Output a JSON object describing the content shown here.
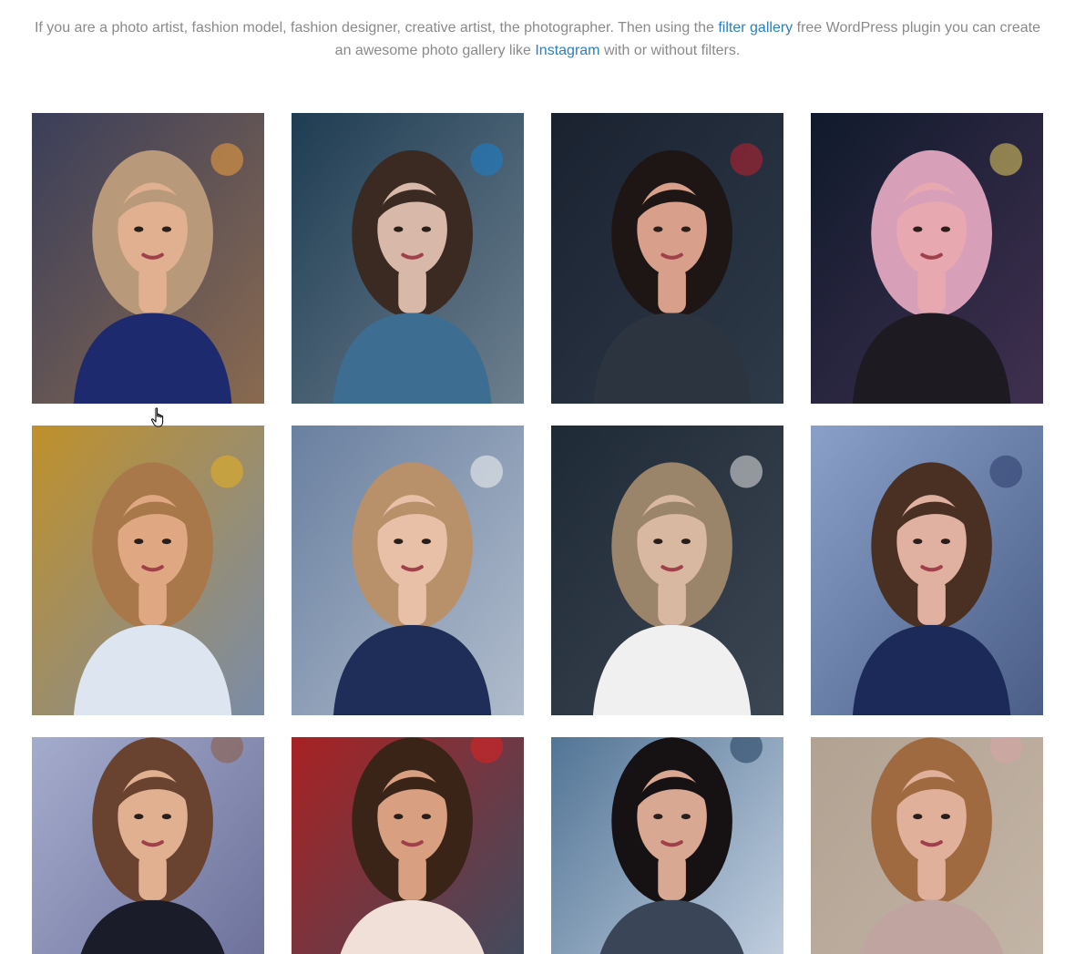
{
  "intro": {
    "text_before_link1": "If you are a photo artist, fashion model, fashion designer, creative artist, the photographer. Then using the ",
    "link1": "filter gallery",
    "text_between": " free WordPress plugin you can create an awesome photo gallery like ",
    "link2": "Instagram",
    "text_after": " with or without filters."
  },
  "colors": {
    "body_text": "#8a8a8a",
    "link": "#2a7fc0"
  },
  "gallery": {
    "photos": [
      {
        "name": "photo-1",
        "bg": [
          "#3a3e5a",
          "#8a6a50"
        ],
        "hair": "#b89a7a",
        "skin": "#e0b090",
        "cloth": "#1e2a6e",
        "accent": "#f0a040",
        "accent_label": "lamp-light"
      },
      {
        "name": "photo-2",
        "bg": [
          "#1f3c52",
          "#6c7f8e"
        ],
        "hair": "#3a2a22",
        "skin": "#d8b8a8",
        "cloth": "#3d6e92",
        "accent": "#1a7fd0",
        "accent_label": "blue-sunglasses"
      },
      {
        "name": "photo-3",
        "bg": [
          "#1a2230",
          "#2e3a48"
        ],
        "hair": "#1e1614",
        "skin": "#d8a08a",
        "cloth": "#2c3440",
        "accent": "#c02030",
        "accent_label": "red-lips"
      },
      {
        "name": "photo-4",
        "bg": [
          "#101a2c",
          "#403050"
        ],
        "hair": "#d8a0b8",
        "skin": "#e8a8b0",
        "cloth": "#1e1a22",
        "accent": "#e8d060",
        "accent_label": "glowing-phone"
      },
      {
        "name": "photo-5",
        "bg": [
          "#c0902a",
          "#7a8ca8"
        ],
        "hair": "#a8784a",
        "skin": "#e0a882",
        "cloth": "#dde6f0",
        "accent": "#e8b020",
        "accent_label": "yellow-pillow"
      },
      {
        "name": "photo-6",
        "bg": [
          "#6a80a0",
          "#b0bccc"
        ],
        "hair": "#b8906a",
        "skin": "#e8c0a8",
        "cloth": "#1e2e58",
        "accent": "#f4f4f4",
        "accent_label": "striped-pillow"
      },
      {
        "name": "photo-7",
        "bg": [
          "#1e2a36",
          "#3c4652"
        ],
        "hair": "#9a846a",
        "skin": "#d8b8a0",
        "cloth": "#f0f0f0",
        "accent": "#e8e8e8",
        "accent_label": "white-fur"
      },
      {
        "name": "photo-8",
        "bg": [
          "#8aa0c8",
          "#4a5e88"
        ],
        "hair": "#4a3022",
        "skin": "#e0b0a0",
        "cloth": "#1c2a5a",
        "accent": "#2a3a6a",
        "accent_label": "navy-dress"
      },
      {
        "name": "photo-9",
        "bg": [
          "#a8b0d0",
          "#6a6e98"
        ],
        "hair": "#6a4230",
        "skin": "#e0b090",
        "cloth": "#1a1c2a",
        "accent": "#8a5a40",
        "accent_label": "round-glasses"
      },
      {
        "name": "photo-10",
        "bg": [
          "#b01e1e",
          "#3a4e62"
        ],
        "hair": "#3a2418",
        "skin": "#d8a080",
        "cloth": "#f0e0d8",
        "accent": "#e02020",
        "accent_label": "red-flowers"
      },
      {
        "name": "photo-11",
        "bg": [
          "#4a6e90",
          "#c8d4e4"
        ],
        "hair": "#161214",
        "skin": "#d8a892",
        "cloth": "#3a4658",
        "accent": "#1e3a5a",
        "accent_label": "window-frame"
      },
      {
        "name": "photo-12",
        "bg": [
          "#b0a090",
          "#c4b6a8"
        ],
        "hair": "#a06a40",
        "skin": "#e0b09a",
        "cloth": "#c0a4a0",
        "accent": "#d8a4a8",
        "accent_label": "pink-beanie"
      }
    ]
  },
  "cursor": {
    "icon": "hand-pointer-icon"
  }
}
